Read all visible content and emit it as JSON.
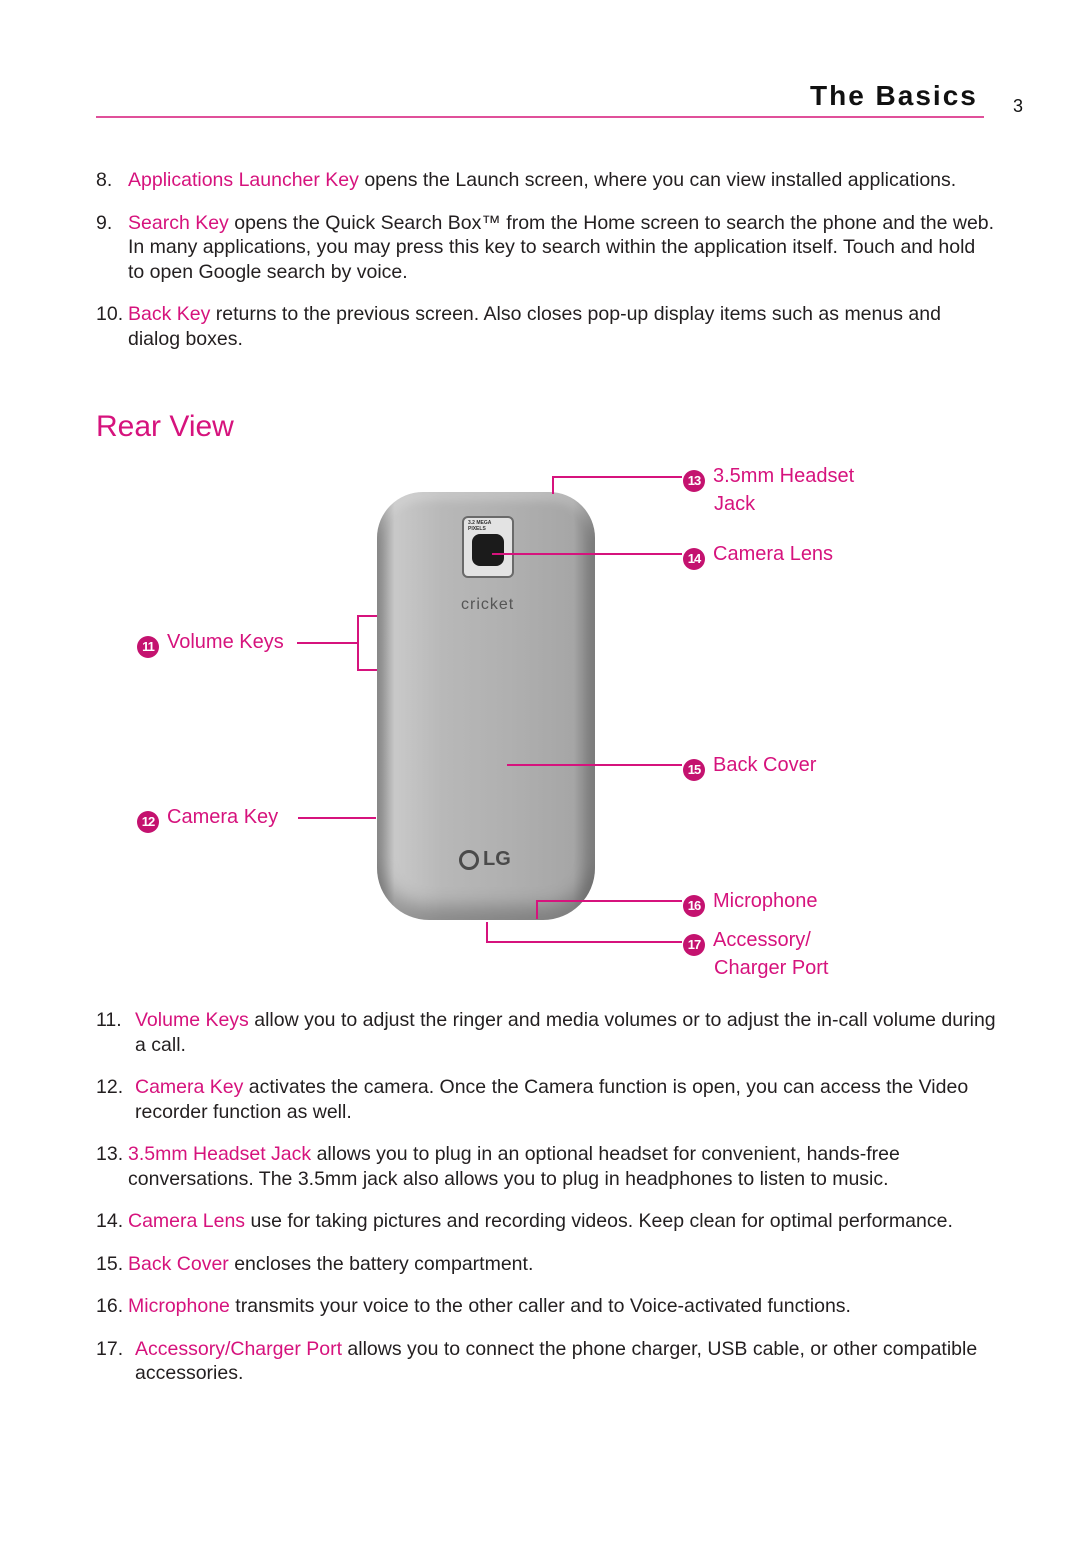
{
  "header": {
    "title": "The Basics",
    "page_number": "3"
  },
  "colors": {
    "accent": "#d6137d",
    "badge": "#c4126f",
    "text": "#231f20"
  },
  "items_top": [
    {
      "num": "8.",
      "term": "Applications Launcher Key",
      "text": " opens the Launch screen, where you can view installed applications."
    },
    {
      "num": "9.",
      "term": "Search Key",
      "text": " opens the Quick Search Box™ from the Home screen to search the phone and the web. In many applications, you may press this key to search within the application itself. Touch and hold to open Google search by voice."
    },
    {
      "num": "10.",
      "term": "Back Key",
      "text": " returns to the previous screen. Also closes pop-up display items such as menus and dialog boxes."
    }
  ],
  "section": {
    "title": "Rear View"
  },
  "diagram": {
    "phone_labels": {
      "camera_badge": "3.2 MEGA PIXELS",
      "carrier": "cricket",
      "maker": "LG"
    },
    "callouts": [
      {
        "num": "11",
        "label": "Volume Keys"
      },
      {
        "num": "12",
        "label": "Camera Key"
      },
      {
        "num": "13",
        "label": "3.5mm Headset",
        "label2": "Jack"
      },
      {
        "num": "14",
        "label": "Camera Lens"
      },
      {
        "num": "15",
        "label": "Back Cover"
      },
      {
        "num": "16",
        "label": "Microphone"
      },
      {
        "num": "17",
        "label": "Accessory/",
        "label2": "Charger Port"
      }
    ]
  },
  "items_bottom": [
    {
      "num": "11.",
      "term": "Volume Keys",
      "text": " allow you to adjust the ringer and media volumes or to adjust the in-call volume during a call."
    },
    {
      "num": "12.",
      "term": "Camera Key",
      "text": " activates the camera. Once the Camera function is open, you can access the Video recorder function as well."
    },
    {
      "num": "13.",
      "term": "3.5mm Headset Jack",
      "text": " allows you to plug in an optional headset for convenient, hands-free conversations. The 3.5mm jack also allows you to plug in headphones to listen to music."
    },
    {
      "num": "14.",
      "term": "Camera Lens",
      "text": " use for taking pictures and recording videos. Keep clean for optimal performance."
    },
    {
      "num": "15.",
      "term": "Back Cover",
      "text": " encloses the battery compartment."
    },
    {
      "num": "16.",
      "term": "Microphone",
      "text": " transmits your voice to the other caller and to Voice-activated functions."
    },
    {
      "num": "17.",
      "term": "Accessory/Charger Port",
      "text": " allows you to connect the phone charger, USB cable, or other compatible accessories."
    }
  ]
}
